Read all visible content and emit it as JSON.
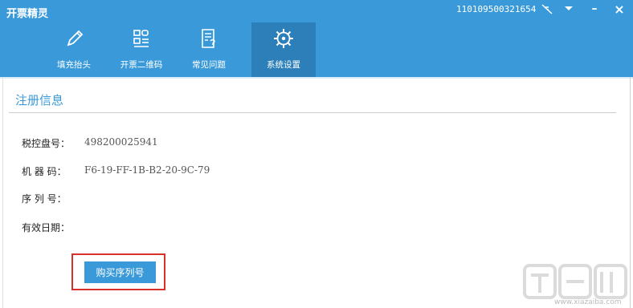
{
  "app": {
    "title": "开票精灵",
    "device_id": "110109500321654"
  },
  "window_controls": {
    "signal_icon": "signal-off-icon",
    "menu_icon": "chevron-down-icon",
    "minimize": "–",
    "close": "×"
  },
  "tabs": [
    {
      "label": "填充抬头",
      "icon": "pencil-icon",
      "active": false
    },
    {
      "label": "开票二维码",
      "icon": "qrcode-icon",
      "active": false
    },
    {
      "label": "常见问题",
      "icon": "faq-icon",
      "active": false
    },
    {
      "label": "系统设置",
      "icon": "gear-icon",
      "active": true
    }
  ],
  "section": {
    "title": "注册信息"
  },
  "fields": {
    "tax_disk_label": "税控盘号：",
    "tax_disk_value": "498200025941",
    "machine_code_label": "机 器 码：",
    "machine_code_value": "F6-19-FF-1B-B2-20-9C-79",
    "serial_label": "序 列 号：",
    "serial_value": "",
    "expiry_label": "有效日期：",
    "expiry_value": ""
  },
  "buy_button": {
    "label": "购买序列号"
  },
  "watermark": {
    "text": "下载吧",
    "url": "www.xiazaiba.com"
  },
  "colors": {
    "primary": "#3a9ad9",
    "active_tab": "#2c7fb8",
    "highlight": "#d9302c"
  }
}
